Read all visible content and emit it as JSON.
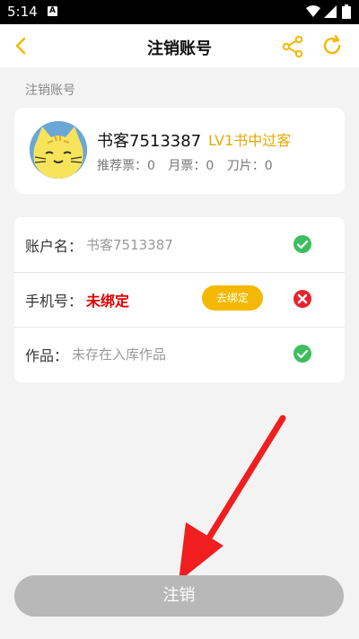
{
  "status_bar": {
    "time": "5:14",
    "notification_icon": "A"
  },
  "nav": {
    "title": "注销账号",
    "back_icon": "chevron-left-icon",
    "share_icon": "share-icon",
    "refresh_icon": "refresh-icon"
  },
  "section_label": "注销账号",
  "profile": {
    "username": "书客7513387",
    "level": "LV1书中过客",
    "stats": [
      "推荐票：0",
      "月票：0",
      "刀片：0"
    ]
  },
  "checks": [
    {
      "label": "账户名：",
      "value": "书客7513387",
      "status": "ok"
    },
    {
      "label": "手机号：",
      "value": "未绑定",
      "button": "去绑定",
      "status": "fail"
    },
    {
      "label": "作品：",
      "value": "未存在入库作品",
      "status": "ok"
    }
  ],
  "submit_label": "注销",
  "colors": {
    "accent": "#f5b800",
    "ok": "#3cbf5c",
    "fail": "#e8232c",
    "arrow": "#f01e1e"
  }
}
